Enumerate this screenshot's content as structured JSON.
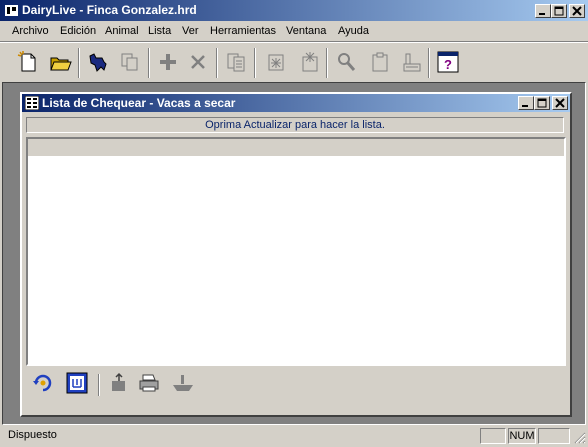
{
  "window": {
    "title": "DairyLive - Finca Gonzalez.hrd"
  },
  "menu": [
    {
      "label": "Archivo"
    },
    {
      "label": "Edición"
    },
    {
      "label": "Animal"
    },
    {
      "label": "Lista"
    },
    {
      "label": "Ver"
    },
    {
      "label": "Herramientas"
    },
    {
      "label": "Ventana"
    },
    {
      "label": "Ayuda"
    }
  ],
  "toolbar_icons": [
    "new-document-icon",
    "open-folder-icon",
    "cow-icon",
    "copy-icon",
    "add-icon",
    "delete-icon",
    "list-report-icon",
    "event-icon",
    "event-multiple-icon",
    "search-icon",
    "clipboard-icon",
    "building-icon",
    "help-icon"
  ],
  "child_window": {
    "title": "Lista de Chequear - Vacas a secar",
    "hint": "Oprima Actualizar para hacer la lista."
  },
  "child_toolbar_icons": [
    "refresh-icon",
    "grid-icon",
    "export-icon",
    "print-icon",
    "ship-icon"
  ],
  "status": {
    "text": "Dispuesto",
    "num_label": "NUM"
  },
  "colors": {
    "title_start": "#0a246a",
    "title_end": "#a6caf0",
    "face": "#d4d0c8"
  }
}
